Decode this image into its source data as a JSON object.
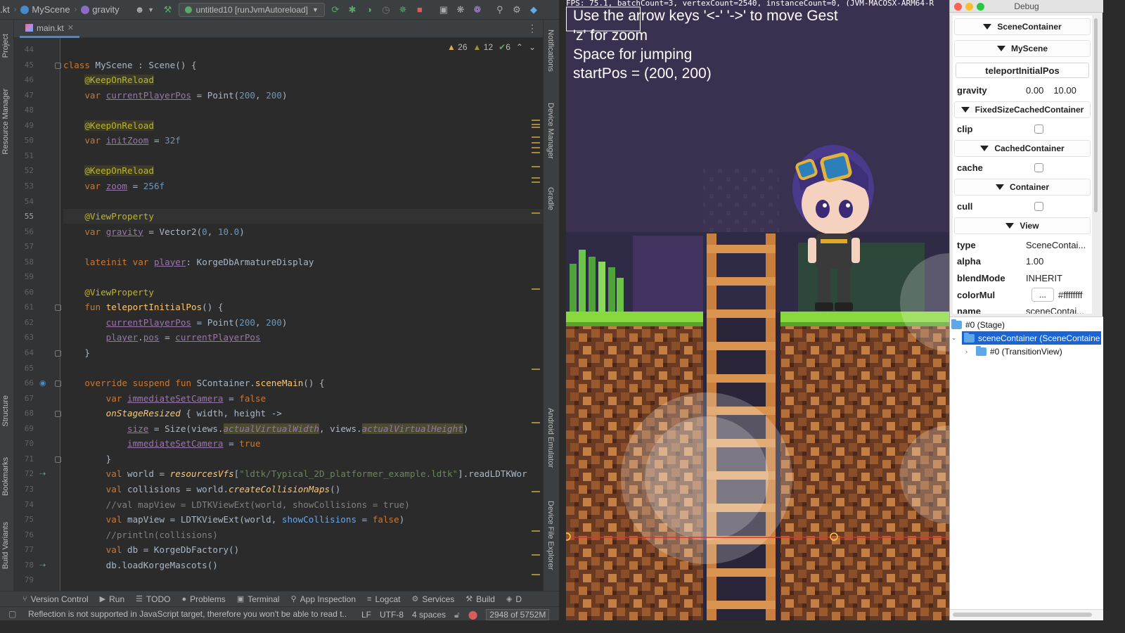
{
  "toolbar": {
    "file_crumb": ".kt",
    "scene_crumb": "MyScene",
    "member_crumb": "gravity",
    "run_config": "untitled10 [runJvmAutoreload]"
  },
  "editor": {
    "tab_label": "main.kt",
    "inspections": {
      "warnings_a": "26",
      "warnings_b": "12",
      "ok": "6"
    },
    "lines": [
      {
        "n": "44",
        "text": ""
      },
      {
        "n": "45",
        "text": "class MyScene : Scene() {"
      },
      {
        "n": "46",
        "text": "    @KeepOnReload"
      },
      {
        "n": "47",
        "text": "    var currentPlayerPos = Point(200, 200)"
      },
      {
        "n": "48",
        "text": ""
      },
      {
        "n": "49",
        "text": "    @KeepOnReload"
      },
      {
        "n": "50",
        "text": "    var initZoom = 32f"
      },
      {
        "n": "51",
        "text": ""
      },
      {
        "n": "52",
        "text": "    @KeepOnReload"
      },
      {
        "n": "53",
        "text": "    var zoom = 256f"
      },
      {
        "n": "54",
        "text": ""
      },
      {
        "n": "55",
        "text": "    @ViewProperty"
      },
      {
        "n": "56",
        "text": "    var gravity = Vector2(0, 10.0)"
      },
      {
        "n": "57",
        "text": ""
      },
      {
        "n": "58",
        "text": "    lateinit var player: KorgeDbArmatureDisplay"
      },
      {
        "n": "59",
        "text": ""
      },
      {
        "n": "60",
        "text": "    @ViewProperty"
      },
      {
        "n": "61",
        "text": "    fun teleportInitialPos() {"
      },
      {
        "n": "62",
        "text": "        currentPlayerPos = Point(200, 200)"
      },
      {
        "n": "63",
        "text": "        player.pos = currentPlayerPos"
      },
      {
        "n": "64",
        "text": "    }"
      },
      {
        "n": "65",
        "text": ""
      },
      {
        "n": "66",
        "text": "    override suspend fun SContainer.sceneMain() {"
      },
      {
        "n": "67",
        "text": "        var immediateSetCamera = false"
      },
      {
        "n": "68",
        "text": "        onStageResized { width, height ->"
      },
      {
        "n": "69",
        "text": "            size = Size(views.actualVirtualWidth, views.actualVirtualHeight)"
      },
      {
        "n": "70",
        "text": "            immediateSetCamera = true"
      },
      {
        "n": "71",
        "text": "        }"
      },
      {
        "n": "72",
        "text": "        val world = resourcesVfs[\"ldtk/Typical_2D_platformer_example.ldtk\"].readLDTKWor"
      },
      {
        "n": "73",
        "text": "        val collisions = world.createCollisionMaps()"
      },
      {
        "n": "74",
        "text": "        //val mapView = LDTKViewExt(world, showCollisions = true)"
      },
      {
        "n": "75",
        "text": "        val mapView = LDTKViewExt(world, showCollisions = false)"
      },
      {
        "n": "76",
        "text": "        //println(collisions)"
      },
      {
        "n": "77",
        "text": "        val db = KorgeDbFactory()"
      },
      {
        "n": "78",
        "text": "        db.loadKorgeMascots()"
      },
      {
        "n": "79",
        "text": ""
      }
    ]
  },
  "left_tabs": [
    "Project",
    "Resource Manager",
    "Structure",
    "Bookmarks",
    "Build Variants"
  ],
  "right_tabs": [
    "Notifications",
    "Device Manager",
    "Gradle",
    "Android Emulator",
    "Device File Explorer"
  ],
  "tool_windows": [
    "Version Control",
    "Run",
    "TODO",
    "Problems",
    "Terminal",
    "App Inspection",
    "Logcat",
    "Services",
    "Build",
    "D"
  ],
  "status": {
    "message": "Reflection is not supported in JavaScript target, therefore you won't be able to read t..",
    "line_sep": "LF",
    "encoding": "UTF-8",
    "indent": "4 spaces",
    "memory": "2948 of 5752M"
  },
  "game": {
    "fps_line": "FPS: 75.1, batchCount=3, vertexCount=2540, instanceCount=0, (JVM-MACOSX-ARM64-R",
    "instructions": [
      "Use the arrow keys '<-' '->' to move Gest",
      "'z' for zoom",
      "Space for jumping",
      "startPos = (200, 200)"
    ]
  },
  "debug": {
    "title": "Debug",
    "sections": {
      "scene_container": "SceneContainer",
      "my_scene": "MyScene",
      "fixed": "FixedSizeCachedContainer",
      "cached": "CachedContainer",
      "container": "Container",
      "view": "View"
    },
    "teleport_button": "teleportInitialPos",
    "gravity": {
      "label": "gravity",
      "x": "0.00",
      "y": "10.00"
    },
    "clip_label": "clip",
    "cache_label": "cache",
    "cull_label": "cull",
    "type": {
      "label": "type",
      "value": "SceneContai..."
    },
    "alpha": {
      "label": "alpha",
      "value": "1.00"
    },
    "blend": {
      "label": "blendMode",
      "value": "INHERIT"
    },
    "colormul": {
      "label": "colorMul",
      "button": "...",
      "value": "#ffffffff"
    },
    "name": {
      "label": "name",
      "value": "sceneContai..."
    },
    "tree": {
      "stage": "#0 (Stage)",
      "scene_container": "sceneContainer (SceneContaine",
      "transition": "#0 (TransitionView)"
    }
  }
}
